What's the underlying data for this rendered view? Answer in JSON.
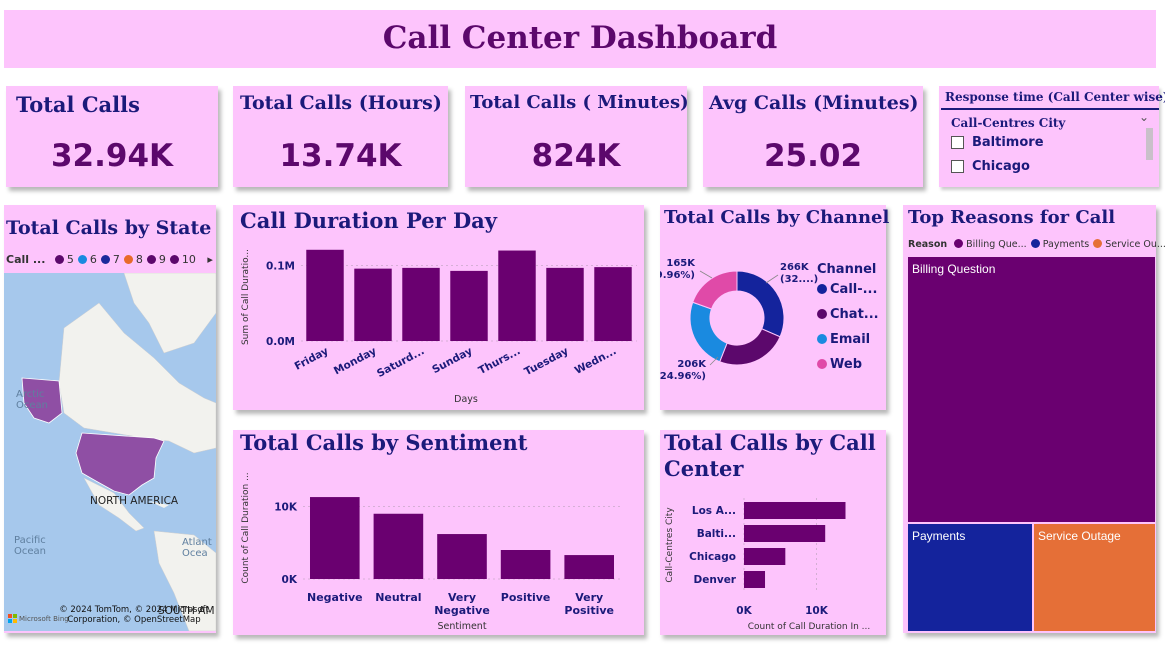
{
  "title": "Call Center Dashboard",
  "kpis": {
    "total_calls": {
      "label": "Total Calls",
      "value": "32.94K"
    },
    "total_hours": {
      "label": "Total Calls (Hours)",
      "value": "13.74K"
    },
    "total_minutes": {
      "label": "Total Calls ( Minutes)",
      "value": "824K"
    },
    "avg_minutes": {
      "label": "Avg Calls (Minutes)",
      "value": "25.02"
    }
  },
  "slicer": {
    "title": "Response time (Call Center wise)",
    "field": "Call-Centres City",
    "items": [
      "Baltimore",
      "Chicago"
    ]
  },
  "map": {
    "title": "Total Calls by State",
    "legend_field": "Call ...",
    "legend": [
      {
        "label": "5",
        "color": "#5c086c"
      },
      {
        "label": "6",
        "color": "#1a8ae0"
      },
      {
        "label": "7",
        "color": "#1b2a9c"
      },
      {
        "label": "8",
        "color": "#e86a2a"
      },
      {
        "label": "9",
        "color": "#5c086c"
      },
      {
        "label": "10",
        "color": "#5c086c"
      }
    ],
    "labels": {
      "arctic": "Arctic\nOcean",
      "north_america": "NORTH AMERICA",
      "pacific": "Pacific\nOcean",
      "atlantic": "Atlant\nOcea",
      "south_america": "SOUTH AM"
    },
    "credit_line1": "© 2024 TomTom, © 2024 Microsoft",
    "credit_line2": "Corporation, © OpenStreetMap",
    "bing": "Microsoft Bing"
  },
  "chart_data": [
    {
      "id": "duration_per_day",
      "type": "bar",
      "title": "Call Duration Per Day",
      "xlabel": "Days",
      "ylabel": "Sum of Call Duratio...",
      "categories": [
        "Friday",
        "Monday",
        "Saturd...",
        "Sunday",
        "Thurs...",
        "Tuesday",
        "Wedn..."
      ],
      "values": [
        0.121,
        0.096,
        0.097,
        0.093,
        0.12,
        0.097,
        0.098
      ],
      "yticks": [
        {
          "v": 0,
          "label": "0.0M"
        },
        {
          "v": 0.1,
          "label": "0.1M"
        }
      ],
      "ylim": [
        0,
        0.13
      ],
      "color": "#6a0070"
    },
    {
      "id": "calls_by_sentiment",
      "type": "bar",
      "title": "Total Calls by Sentiment",
      "xlabel": "Sentiment",
      "ylabel": "Count of Call Duration ...",
      "categories": [
        "Negative",
        "Neutral",
        "Very\nNegative",
        "Positive",
        "Very\nPositive"
      ],
      "values": [
        11300,
        9000,
        6200,
        4000,
        3300
      ],
      "yticks": [
        {
          "v": 0,
          "label": "0K"
        },
        {
          "v": 10000,
          "label": "10K"
        }
      ],
      "ylim": [
        0,
        12000
      ],
      "color": "#6a0070"
    },
    {
      "id": "calls_by_channel",
      "type": "pie",
      "title": "Total Calls by Channel",
      "legend_title": "Channel",
      "slices": [
        {
          "name": "Call-...",
          "value": 266,
          "label1": "266K",
          "label2": "(32....)",
          "color": "#14239c"
        },
        {
          "name": "Chat...",
          "value": 206,
          "label1": "",
          "label2": "",
          "color": "#5c086c"
        },
        {
          "name": "Email",
          "value": 206,
          "label1": "206K",
          "label2": "(24.96%)",
          "color": "#1a8ae0"
        },
        {
          "name": "Web",
          "value": 165,
          "label1": "165K",
          "label2": "(19.96%)",
          "color": "#e04aa8"
        }
      ]
    },
    {
      "id": "calls_by_center",
      "type": "bar",
      "orientation": "horizontal",
      "title": "Total Calls by Call Center",
      "ylabel": "Call-Centres City",
      "xlabel": "Count of Call Duration In ...",
      "categories": [
        "Los A...",
        "Balti...",
        "Chicago",
        "Denver"
      ],
      "values": [
        14000,
        11200,
        5700,
        2900
      ],
      "xticks": [
        {
          "v": 0,
          "label": "0K"
        },
        {
          "v": 10000,
          "label": "10K"
        }
      ],
      "xlim": [
        0,
        16000
      ],
      "color": "#6a0070"
    },
    {
      "id": "top_reasons",
      "type": "treemap",
      "title": "Top Reasons for Call",
      "legend_field": "Reason",
      "items": [
        {
          "name": "Billing Question",
          "legend": "Billing Que...",
          "color": "#6a0070"
        },
        {
          "name": "Payments",
          "legend": "Payments",
          "color": "#14239c"
        },
        {
          "name": "Service Outage",
          "legend": "Service Ou...",
          "color": "#e56f37"
        }
      ]
    }
  ]
}
